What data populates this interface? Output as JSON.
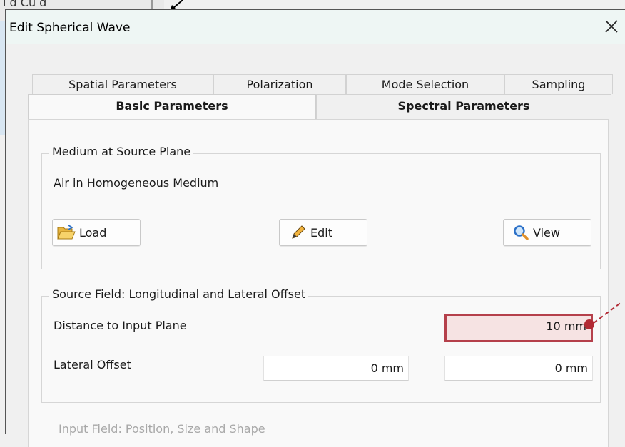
{
  "background": {
    "partial_text": "l d Cu    d"
  },
  "dialog": {
    "title": "Edit Spherical Wave",
    "close_label": "✕"
  },
  "tabs": {
    "back_row": [
      {
        "label": "Spatial Parameters"
      },
      {
        "label": "Polarization"
      },
      {
        "label": "Mode Selection"
      },
      {
        "label": "Sampling"
      }
    ],
    "front_row": [
      {
        "label": "Basic Parameters",
        "active": true
      },
      {
        "label": "Spectral Parameters",
        "active": false
      }
    ]
  },
  "medium": {
    "group_title": "Medium at Source Plane",
    "name": "Air in Homogeneous Medium",
    "load_label": "Load",
    "edit_label": "Edit",
    "view_label": "View"
  },
  "source_field": {
    "group_title": "Source Field: Longitudinal and Lateral Offset",
    "distance_label": "Distance to Input Plane",
    "distance_value": "10 mm",
    "lateral_label": "Lateral Offset",
    "lateral_x": "0 mm",
    "lateral_y": "0 mm"
  },
  "input_field": {
    "group_title": "Input Field: Position, Size and Shape"
  },
  "colors": {
    "highlight_border": "#b5404b",
    "highlight_fill": "#f6e3e3",
    "title_bar": "#eef6f4"
  }
}
